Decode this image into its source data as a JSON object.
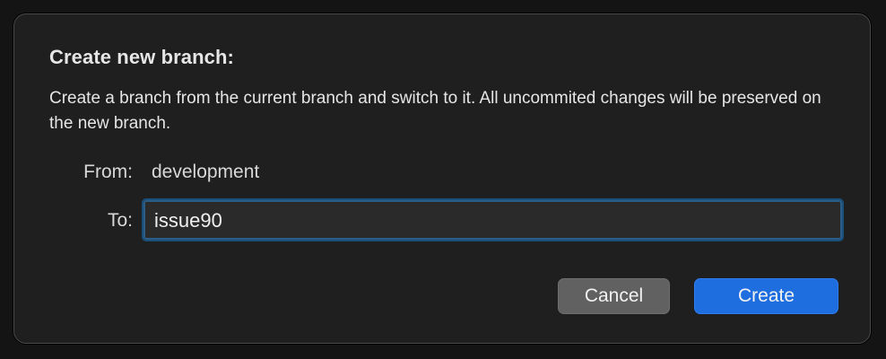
{
  "dialog": {
    "title": "Create new branch:",
    "description": "Create a branch from the current branch and switch to it. All uncommited changes will be preserved on the new branch.",
    "from_label": "From:",
    "from_value": "development",
    "to_label": "To:",
    "to_value": "issue90",
    "cancel_label": "Cancel",
    "create_label": "Create"
  },
  "colors": {
    "background": "#1f1f1f",
    "accent": "#1f6ee0",
    "focus_ring": "#2c5d86"
  }
}
